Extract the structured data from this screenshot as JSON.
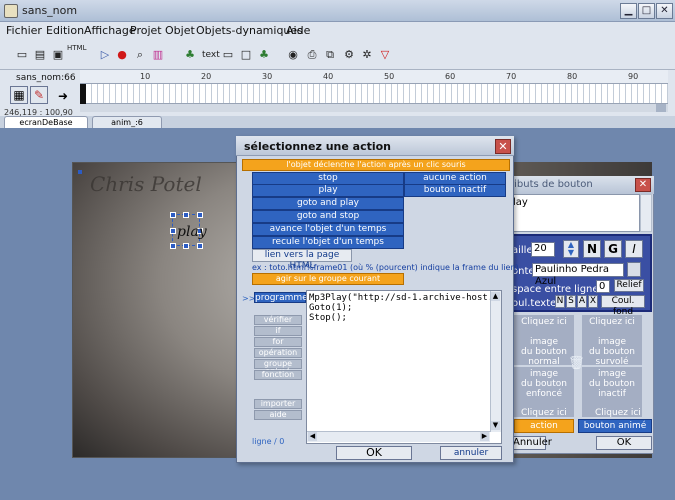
{
  "window": {
    "title": "sans_nom"
  },
  "menu": [
    "Fichier",
    "Edition",
    "Affichage",
    "Projet",
    "Objet",
    "Objets-dynamiques",
    "Aide"
  ],
  "toolbar": {
    "html_label": "HTML",
    "text_label": "text"
  },
  "timeline": {
    "scene_label": "sans_nom:66",
    "ruler_numbers": [
      "10",
      "20",
      "30",
      "40",
      "50",
      "60",
      "70",
      "80",
      "90"
    ],
    "coords": "246,119 : 100,90"
  },
  "tabs": [
    "ecranDeBase",
    "anim_:6"
  ],
  "canvas": {
    "signature": "Chris Potel",
    "play_text": "play"
  },
  "attributes": {
    "title": "ributs de bouton",
    "text_value": "lay",
    "size_label": "aille",
    "size_value": "20",
    "bold_btn": "N",
    "gras_btn": "G",
    "italic_btn": "I",
    "font_label": "onte",
    "font_value": "Paulinho Pedra Azul",
    "spacing_label": "space entre lignes",
    "spacing_value": "0",
    "relief_btn": "Relief",
    "color_label": "oul.texte",
    "color_btns": [
      "N",
      "S",
      "A",
      "X"
    ],
    "bg_color_btn": "Coul. fond",
    "states": [
      {
        "top": "Cliquez ici",
        "l1": "image",
        "l2": "du bouton",
        "l3": "normal"
      },
      {
        "top": "Cliquez ici",
        "l1": "image",
        "l2": "du bouton",
        "l3": "survolé"
      },
      {
        "top": "",
        "l1": "image",
        "l2": "du bouton",
        "l3": "enfoncé"
      },
      {
        "top": "",
        "l1": "image",
        "l2": "du bouton",
        "l3": "inactif"
      }
    ],
    "click_here_3": "Cliquez ici",
    "click_here_4": "Cliquez ici",
    "action_btn": "action",
    "anim_btn": "bouton animé",
    "cancel": "Annuler",
    "ok": "OK"
  },
  "dialog": {
    "title": "sélectionnez une action",
    "header": "l'objet déclenche l'action après un clic souris",
    "actions_left": [
      "stop",
      "play",
      "goto and play",
      "goto and stop",
      "avance l'objet d'un temps",
      "recule l'objet d'un temps"
    ],
    "actions_right": [
      "aucune action",
      "bouton inactif"
    ],
    "link_html": "lien vers la page HTML",
    "hint": "ex : toto.html%frame01 (où % (pourcent) indique la frame du lien)",
    "group_bar": "agir sur le groupe courant",
    "arrow": ">>",
    "program_btn": "programmer",
    "side_buttons": [
      "vérifier",
      "if",
      "for",
      "opération",
      "groupe animé",
      "fonction"
    ],
    "side_buttons_2": [
      "importer",
      "aide"
    ],
    "code_lines": [
      "Mp3Play(\"http://sd-1.archive-host.com/mem",
      "Goto(1);",
      "Stop();"
    ],
    "line_status": "ligne / 0",
    "ok": "OK",
    "cancel": "annuler"
  },
  "colors": {
    "accent_orange": "#f4a31c",
    "action_blue": "#2f64c0",
    "attr_blue": "#3a4fa3"
  }
}
